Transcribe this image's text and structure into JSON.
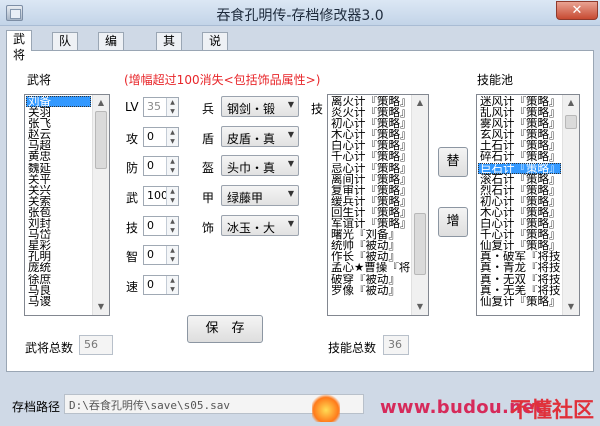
{
  "window": {
    "title": "吞食孔明传-存档修改器3.0",
    "close": "✕"
  },
  "tabs": [
    "武将",
    "队伍",
    "编成所",
    "其他",
    "说明"
  ],
  "general_section": {
    "label": "武将",
    "list": [
      "刘备",
      "关羽",
      "张飞",
      "赵云",
      "马超",
      "黄忠",
      "魏延",
      "关平",
      "关兴",
      "关索",
      "张苞",
      "刘封",
      "马岱",
      "星彩",
      "孔明",
      "庞统",
      "徐庶",
      "马良",
      "马谡"
    ],
    "selected_index": 0,
    "count_label": "武将总数",
    "count_value": "56"
  },
  "notice": "(增幅超过100消失<包括饰品属性>)",
  "stats": [
    {
      "label": "LV",
      "value": "35",
      "disabled": true
    },
    {
      "label": "攻",
      "value": "0"
    },
    {
      "label": "防",
      "value": "0"
    },
    {
      "label": "武",
      "value": "100"
    },
    {
      "label": "技",
      "value": "0"
    },
    {
      "label": "智",
      "value": "0"
    },
    {
      "label": "速",
      "value": "0"
    }
  ],
  "equipment": [
    {
      "label": "兵",
      "value": "钢剑・锻"
    },
    {
      "label": "盾",
      "value": "皮盾・真"
    },
    {
      "label": "盔",
      "value": "头巾・真"
    },
    {
      "label": "甲",
      "value": "绿藤甲"
    },
    {
      "label": "饰",
      "value": "冰玉・大"
    }
  ],
  "skills": {
    "label": "技",
    "list": [
      "离火计『策略』",
      "炎火计『策略』",
      "初心计『策略』",
      "木心计『策略』",
      "白心计『策略』",
      "千心计『策略』",
      "忌心计『策略』",
      "离间计『策略』",
      "复审计『策略』",
      "缓兵计『策略』",
      "回生计『策略』",
      "军谊计『策略』",
      "曙光『刘备』",
      "统帅『被动』",
      "作长『被动』",
      "孟心★曹操『将扯",
      "破穿『被动』",
      "罗像『被动』"
    ],
    "count_label": "技能总数",
    "count_value": "36"
  },
  "skill_pool": {
    "label": "技能池",
    "list": [
      "迷风计『策略』",
      "乱风计『策略』",
      "雾风计『策略』",
      "玄风计『策略』",
      "土石计『策略』",
      "碎石计『策略』",
      "巨石计『策略』",
      "滚石计『策略』",
      "烈石计『策略』",
      "初心计『策略』",
      "木心计『策略』",
      "白心计『策略』",
      "千心计『策略』",
      "仙复计『策略』",
      "真・破军『将技",
      "真・青龙『将技",
      "真・无双『将技",
      "真・无羌『将技",
      "仙复计『策略』"
    ],
    "selected_index": 6
  },
  "buttons": {
    "replace": "替",
    "add": "增",
    "save": "保　存"
  },
  "path": {
    "label": "存档路径",
    "value": "D:\\吞食孔明传\\save\\s05.sav"
  },
  "watermark": {
    "url": "www.budou.net",
    "brand": "不懂社区"
  },
  "colors": {
    "selection": "#3399ff",
    "notice": "#e8262a"
  }
}
